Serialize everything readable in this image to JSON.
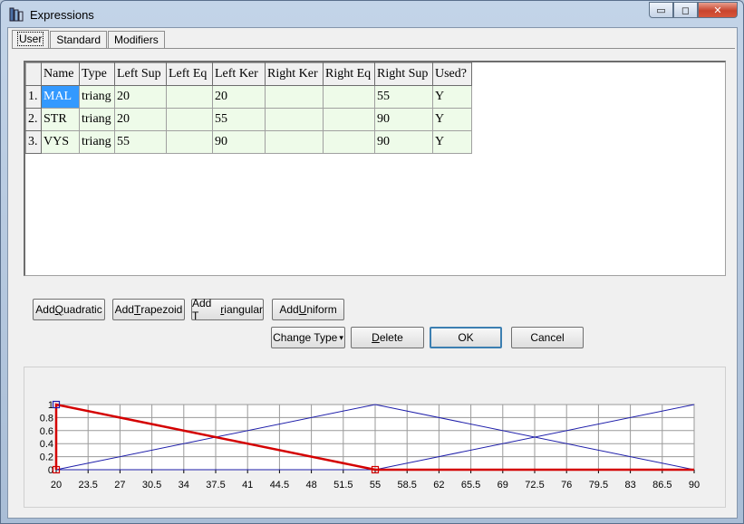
{
  "window": {
    "title": "Expressions"
  },
  "caption_buttons": {
    "minimize": "▭",
    "maximize": "◻",
    "close": "✕"
  },
  "tabs": [
    {
      "label": "User",
      "active": true
    },
    {
      "label": "Standard",
      "active": false
    },
    {
      "label": "Modifiers",
      "active": false
    }
  ],
  "table": {
    "columns": [
      "Name",
      "Type",
      "Left Sup",
      "Left Eq",
      "Left Ker",
      "Right Ker",
      "Right Eq",
      "Right Sup",
      "Used?"
    ],
    "rows": [
      {
        "index": "1.",
        "cells": [
          "MAL",
          "triang",
          "20",
          "",
          "20",
          "",
          "",
          "55",
          "Y"
        ]
      },
      {
        "index": "2.",
        "cells": [
          "STR",
          "triang",
          "20",
          "",
          "55",
          "",
          "",
          "90",
          "Y"
        ]
      },
      {
        "index": "3.",
        "cells": [
          "VYS",
          "triang",
          "55",
          "",
          "90",
          "",
          "",
          "90",
          "Y"
        ]
      }
    ]
  },
  "buttons": {
    "add_quadratic": {
      "pre": "Add ",
      "acc": "Q",
      "post": "uadratic"
    },
    "add_trapezoid": {
      "pre": "Add ",
      "acc": "T",
      "post": "rapezoid"
    },
    "add_triangular": {
      "pre": "Add T",
      "acc": "r",
      "post": "iangular"
    },
    "add_uniform": {
      "pre": "Add ",
      "acc": "U",
      "post": "niform"
    },
    "change_type": {
      "label": "Change Type",
      "arrow": "▾"
    },
    "delete": {
      "pre": "",
      "acc": "D",
      "post": "elete"
    },
    "ok": {
      "label": "OK"
    },
    "cancel": {
      "label": "Cancel"
    }
  },
  "colors": {
    "selected_series": "#d40000",
    "other_series": "#1e1eaa",
    "grid": "#9a9a9a",
    "cell_bg": "#eefbe9",
    "selection": "#3399ff"
  },
  "chart_data": {
    "type": "line",
    "xlim": [
      20,
      90
    ],
    "ylim": [
      0,
      1
    ],
    "x_ticks": [
      "20",
      "23.5",
      "27",
      "30.5",
      "34",
      "37.5",
      "41",
      "44.5",
      "48",
      "51.5",
      "55",
      "58.5",
      "62",
      "65.5",
      "69",
      "72.5",
      "76",
      "79.5",
      "83",
      "86.5",
      "90"
    ],
    "y_ticks": [
      "0",
      "0.2",
      "0.4",
      "0.6",
      "0.8",
      "1"
    ],
    "series": [
      {
        "name": "MAL",
        "points": [
          [
            20,
            0
          ],
          [
            20,
            1
          ],
          [
            55,
            0
          ],
          [
            90,
            0
          ]
        ],
        "selected": true
      },
      {
        "name": "STR",
        "points": [
          [
            20,
            0
          ],
          [
            55,
            1
          ],
          [
            90,
            0
          ]
        ],
        "selected": false
      },
      {
        "name": "VYS",
        "points": [
          [
            20,
            0
          ],
          [
            55,
            0
          ],
          [
            90,
            1
          ]
        ],
        "selected": false
      }
    ]
  }
}
